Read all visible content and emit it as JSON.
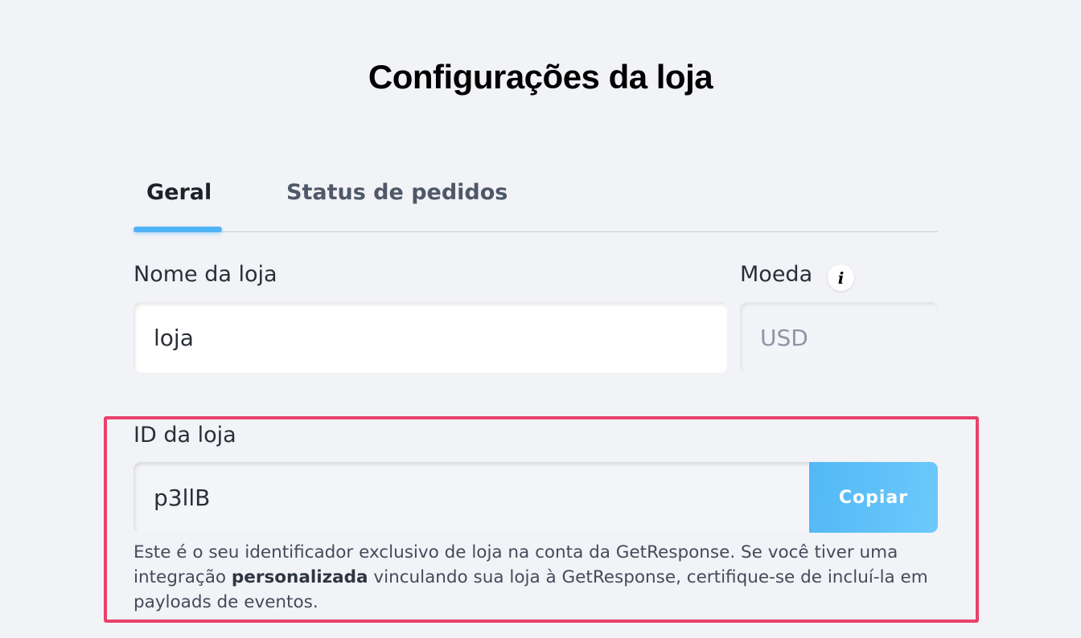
{
  "page": {
    "title": "Configurações da loja"
  },
  "tabs": [
    {
      "label": "Geral",
      "active": true
    },
    {
      "label": "Status de pedidos",
      "active": false
    }
  ],
  "form": {
    "store_name": {
      "label": "Nome da loja",
      "value": "loja"
    },
    "currency": {
      "label": "Moeda",
      "value": "USD",
      "info_icon": "info-icon"
    },
    "store_id": {
      "label": "ID da loja",
      "value": "p3llB",
      "copy_label": "Copiar",
      "help_part1": "Este é o seu identificador exclusivo de loja na conta da GetResponse. Se você tiver uma integração ",
      "help_bold": "personalizada",
      "help_part2": " vinculando sua loja à GetResponse, certifique-se de incluí-la em payloads de eventos."
    }
  },
  "colors": {
    "accent": "#4fb3f6",
    "highlight_border": "#e8426a",
    "background": "#f2f3f7"
  }
}
